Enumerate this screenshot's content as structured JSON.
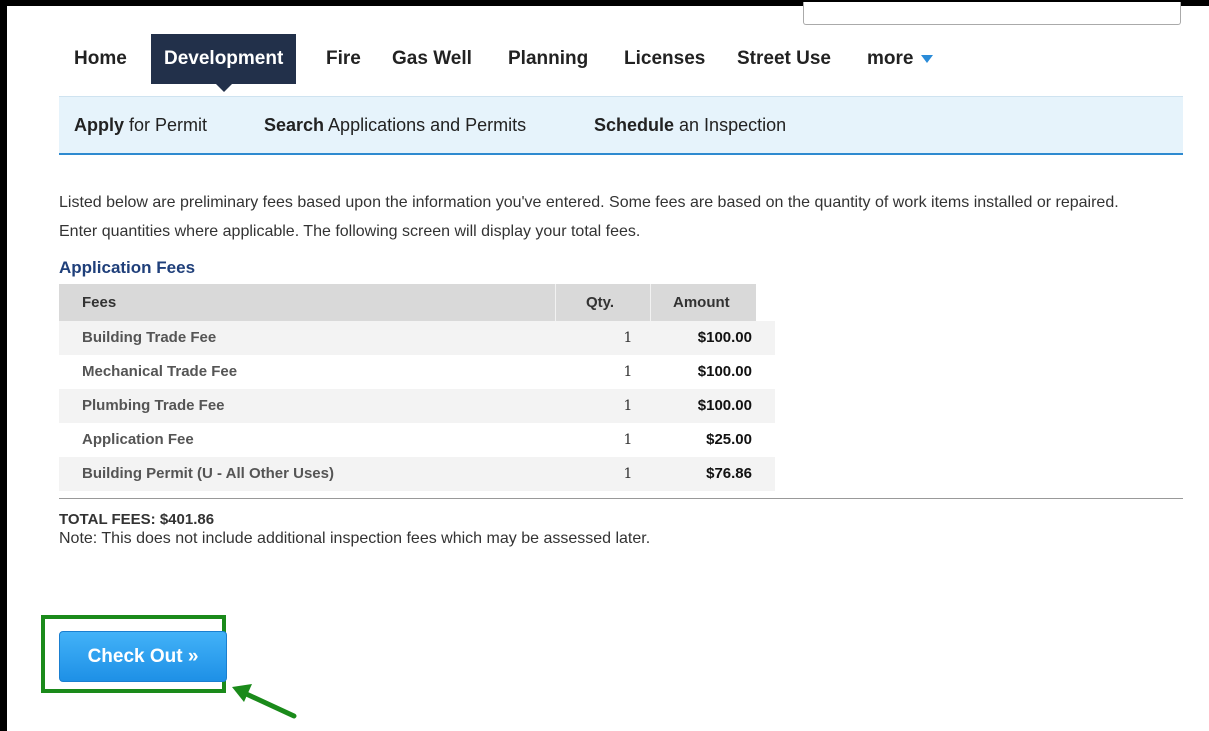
{
  "nav": {
    "items": [
      "Home",
      "Development",
      "Fire",
      "Gas Well",
      "Planning",
      "Licenses",
      "Street Use",
      "more"
    ],
    "active_index": 1
  },
  "subnav": [
    {
      "bold": "Apply",
      "rest": " for Permit"
    },
    {
      "bold": "Search",
      "rest": " Applications and Permits"
    },
    {
      "bold": "Schedule",
      "rest": " an Inspection"
    }
  ],
  "intro_text": "Listed below are preliminary fees based upon the information you've entered. Some fees are based on the quantity of work items installed or repaired. Enter quantities where applicable. The following screen will display your total fees.",
  "section_title": "Application Fees",
  "fees_table": {
    "headers": {
      "fees": "Fees",
      "qty": "Qty.",
      "amount": "Amount"
    },
    "rows": [
      {
        "name": "Building Trade Fee",
        "qty": "1",
        "amount": "$100.00"
      },
      {
        "name": "Mechanical Trade Fee",
        "qty": "1",
        "amount": "$100.00"
      },
      {
        "name": "Plumbing Trade Fee",
        "qty": "1",
        "amount": "$100.00"
      },
      {
        "name": "Application Fee",
        "qty": "1",
        "amount": "$25.00"
      },
      {
        "name": "Building Permit (U - All Other Uses)",
        "qty": "1",
        "amount": "$76.86"
      }
    ]
  },
  "total_text": "TOTAL FEES: $401.86",
  "note_text": "Note: This does not include additional inspection fees which may be assessed later.",
  "checkout_label": "Check Out »",
  "colors": {
    "nav_active": "#22304a",
    "subnav_bg": "#e6f3fb",
    "accent_blue": "#2e8ad0",
    "button_blue": "#1e90e6",
    "highlight_green": "#1a8a1a",
    "title_blue": "#1f3f7a"
  }
}
